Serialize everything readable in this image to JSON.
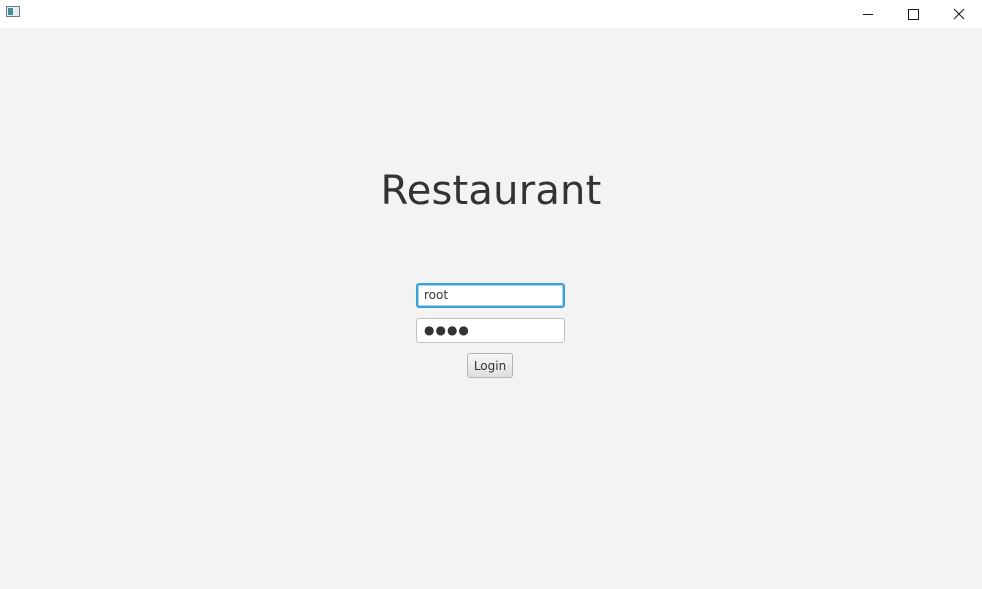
{
  "titlebar": {
    "icon": "app-window-icon",
    "buttons": {
      "minimize_icon": "minimize-icon",
      "maximize_icon": "maximize-icon",
      "close_icon": "close-icon"
    }
  },
  "login": {
    "heading": "Restaurant",
    "username_value": "root",
    "password_display": "●●●●",
    "button_label": "Login"
  },
  "colors": {
    "background": "#f3f3f3",
    "focus_border": "#3aa0d8",
    "heading_text": "#333333"
  }
}
